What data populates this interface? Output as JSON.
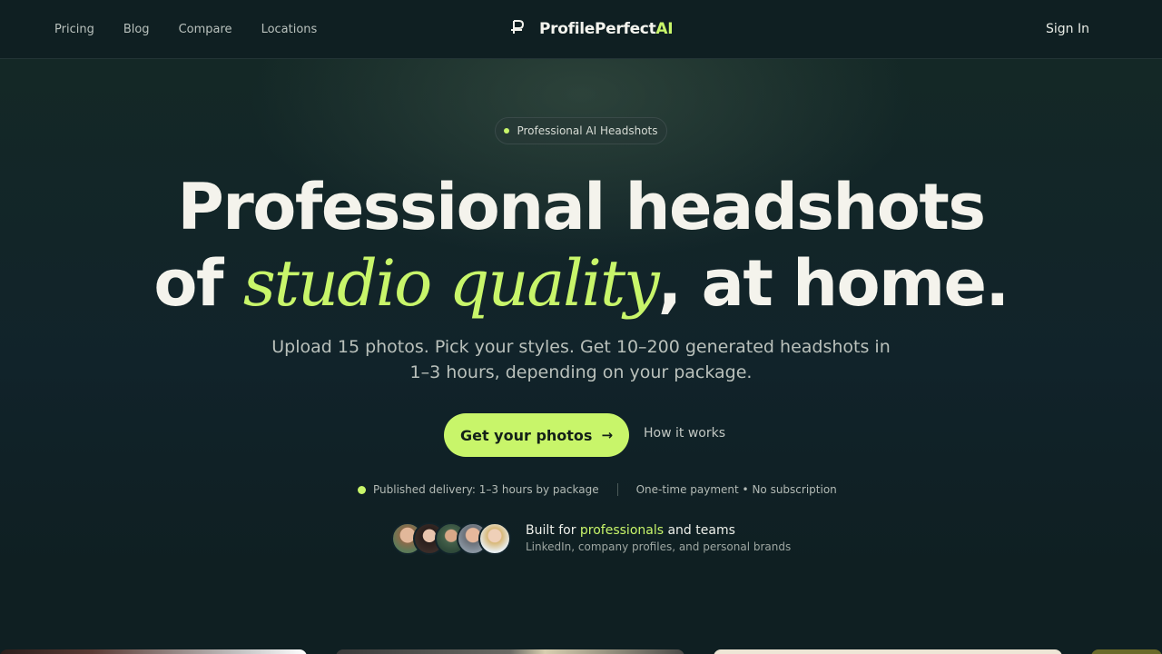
{
  "nav": {
    "links": [
      "Pricing",
      "Blog",
      "Compare",
      "Locations"
    ],
    "brand_mark": "P",
    "brand_name": "ProfilePerfect",
    "brand_suffix": "AI",
    "sign_in": "Sign In"
  },
  "hero": {
    "badge": "Professional AI Headshots",
    "headline_line1": "Professional headshots",
    "headline_of": "of ",
    "headline_em": "studio quality",
    "headline_end": ", at home.",
    "subtitle": "Upload 15 photos. Pick your styles. Get 10–200 generated headshots in 1–3 hours, depending on your package.",
    "cta_label": "Get your photos",
    "cta_icon": "arrow-right-icon",
    "secondary_link": "How it works",
    "meta_delivery": "Published delivery: 1–3 hours by package",
    "meta_payment": "One-time payment • No subscription",
    "social_title_pre": "Built for ",
    "social_title_hl": "professionals",
    "social_title_post": " and teams",
    "social_sub": "LinkedIn, company profiles, and personal brands"
  },
  "colors": {
    "background": "#0f1f22",
    "accent": "#c8f56a",
    "text": "#f4f3ec"
  }
}
